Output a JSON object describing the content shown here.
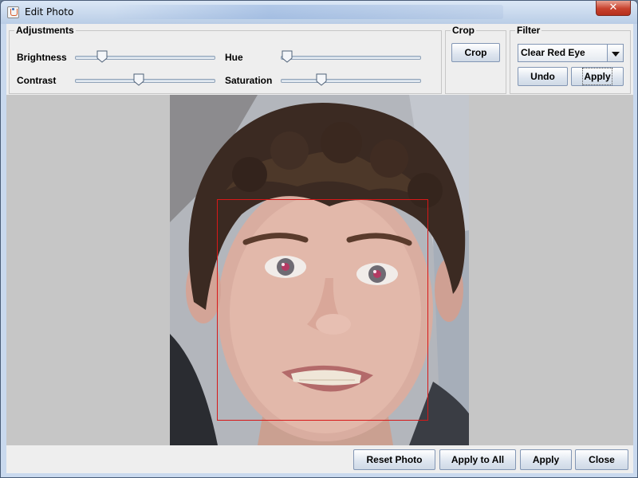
{
  "window": {
    "title": "Edit Photo",
    "close_glyph": "✕"
  },
  "adjustments": {
    "legend": "Adjustments",
    "sliders": [
      {
        "label": "Brightness",
        "value": 0.16
      },
      {
        "label": "Hue",
        "value": 0.0
      },
      {
        "label": "Contrast",
        "value": 0.45
      },
      {
        "label": "Saturation",
        "value": 0.27
      }
    ]
  },
  "crop": {
    "legend": "Crop",
    "button": "Crop"
  },
  "filter": {
    "legend": "Filter",
    "selected": "Clear Red Eye",
    "undo": "Undo",
    "apply": "Apply"
  },
  "photo": {
    "face_box_color": "#d81818"
  },
  "footer": {
    "reset": "Reset Photo",
    "apply_all": "Apply to All",
    "apply": "Apply",
    "close": "Close"
  },
  "colors": {
    "titlebar": "#c9d9ee",
    "panel": "#eeeeee",
    "canvas": "#c6c6c6",
    "close_button": "#c7412d"
  },
  "icons": [
    "java-app-icon",
    "close-icon",
    "chevron-down-icon",
    "slider-thumb-icon"
  ]
}
